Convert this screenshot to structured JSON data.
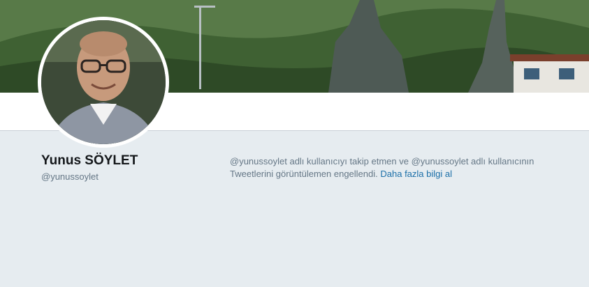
{
  "profile": {
    "name": "Yunus SÖYLET",
    "handle": "@yunussoylet"
  },
  "notice": {
    "message": "@yunussoylet adlı kullanıcıyı takip etmen ve @yunussoylet adlı kullanıcının Tweetlerini görüntülemen engellendi.",
    "link_label": "Daha fazla bilgi al"
  },
  "colors": {
    "page_background": "#e6ecf0",
    "link": "#1b6fa8",
    "muted_text": "#657786"
  }
}
